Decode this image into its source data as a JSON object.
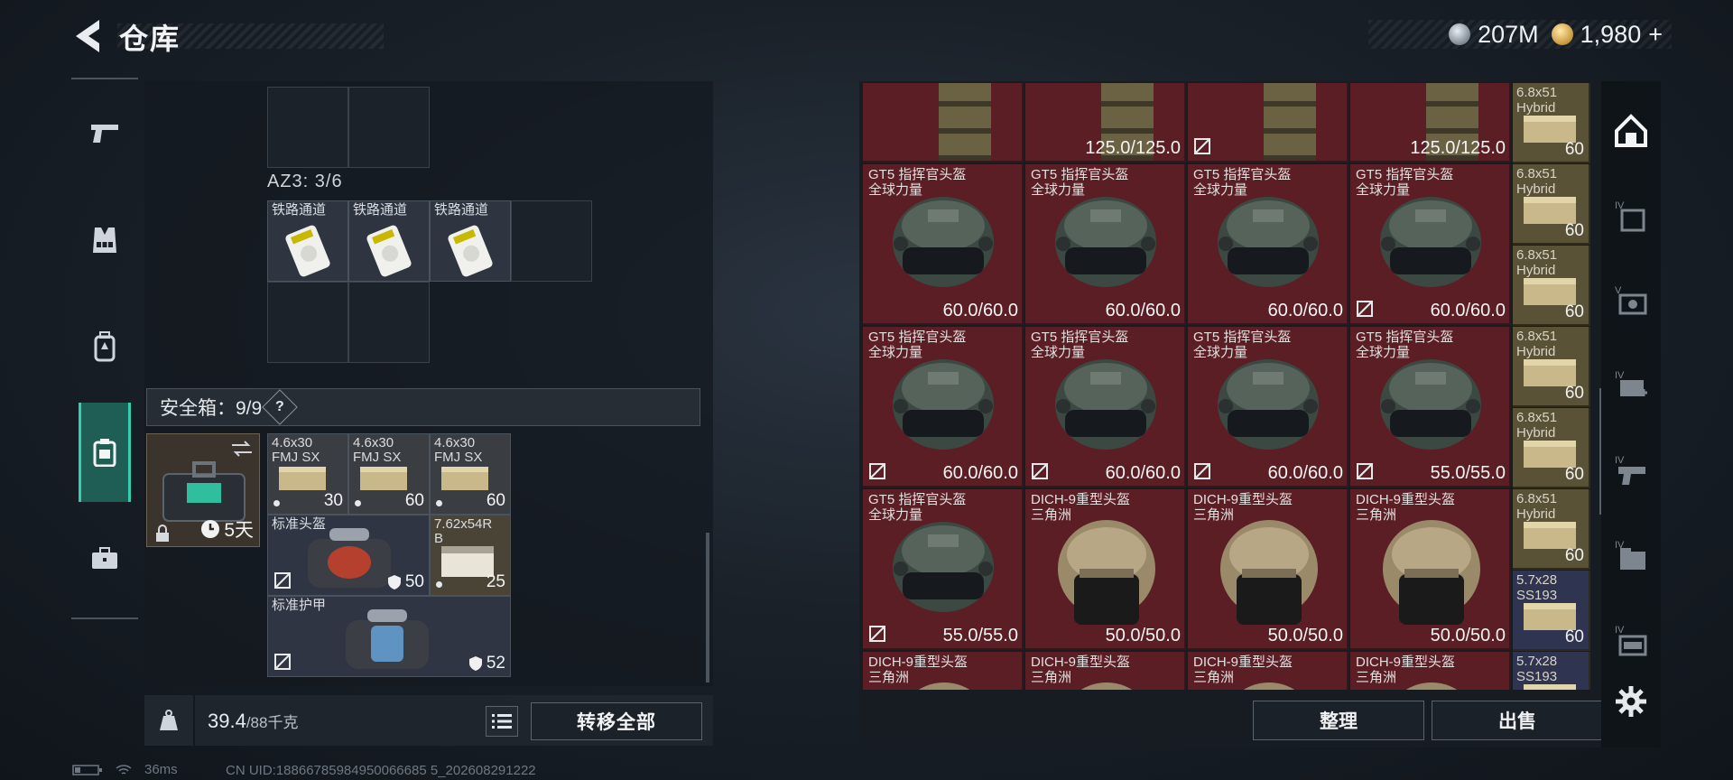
{
  "header": {
    "title": "仓库"
  },
  "currency": {
    "silver": "207M",
    "gold": "1,980",
    "gold_plus": "+"
  },
  "left_nav": {
    "items": [
      "weapon",
      "vest",
      "backpack",
      "safebox",
      "case"
    ],
    "active": "safebox"
  },
  "az3": {
    "label": "AZ3: 3/6",
    "items": [
      {
        "name": "铁路通道"
      },
      {
        "name": "铁路通道"
      },
      {
        "name": "铁路通道"
      }
    ]
  },
  "safebox": {
    "label": "安全箱：9/9",
    "help": "?",
    "days": "5天",
    "items": [
      {
        "name": "4.6x30\nFMJ SX",
        "count": "30"
      },
      {
        "name": "4.6x30\nFMJ SX",
        "count": "60"
      },
      {
        "name": "4.6x30\nFMJ SX",
        "count": "60"
      },
      {
        "name": "标准头盔",
        "count": "50"
      },
      {
        "name": "7.62x54R\nB",
        "count": "25"
      },
      {
        "name": "标准护甲",
        "count": "52"
      }
    ]
  },
  "weight": {
    "current": "39.4",
    "max": "/88千克"
  },
  "buttons": {
    "transfer": "转移全部",
    "sort": "整理",
    "sell": "出售"
  },
  "stash": {
    "row0": [
      {
        "name": "",
        "dur": ""
      },
      {
        "name": "",
        "dur": "125.0/125.0"
      },
      {
        "name": "",
        "dur": ""
      },
      {
        "name": "",
        "dur": "125.0/125.0"
      }
    ],
    "helmets": [
      {
        "name": "GT5 指挥官头盔\n全球力量",
        "dur": "60.0/60.0",
        "nocross": false
      },
      {
        "name": "GT5 指挥官头盔\n全球力量",
        "dur": "60.0/60.0",
        "nocross": false
      },
      {
        "name": "GT5 指挥官头盔\n全球力量",
        "dur": "60.0/60.0",
        "nocross": false
      },
      {
        "name": "GT5 指挥官头盔\n全球力量",
        "dur": "60.0/60.0",
        "nocross": true
      },
      {
        "name": "GT5 指挥官头盔\n全球力量",
        "dur": "60.0/60.0",
        "nocross": true
      },
      {
        "name": "GT5 指挥官头盔\n全球力量",
        "dur": "60.0/60.0",
        "nocross": true
      },
      {
        "name": "GT5 指挥官头盔\n全球力量",
        "dur": "60.0/60.0",
        "nocross": true
      },
      {
        "name": "GT5 指挥官头盔\n全球力量",
        "dur": "55.0/55.0",
        "nocross": true
      },
      {
        "name": "GT5 指挥官头盔\n全球力量",
        "dur": "55.0/55.0",
        "nocross": true
      },
      {
        "name": "DICH-9重型头盔\n三角洲",
        "dur": "50.0/50.0",
        "nocross": false
      },
      {
        "name": "DICH-9重型头盔\n三角洲",
        "dur": "50.0/50.0",
        "nocross": false
      },
      {
        "name": "DICH-9重型头盔\n三角洲",
        "dur": "50.0/50.0",
        "nocross": false
      },
      {
        "name": "DICH-9重型头盔\n三角洲",
        "dur": "",
        "nocross": false
      },
      {
        "name": "DICH-9重型头盔\n三角洲",
        "dur": "",
        "nocross": false
      },
      {
        "name": "DICH-9重型头盔\n三角洲",
        "dur": "",
        "nocross": false
      },
      {
        "name": "DICH-9重型头盔\n三角洲",
        "dur": "",
        "nocross": false
      }
    ],
    "ammo": [
      {
        "name": "6.8x51\nHybrid",
        "count": "60",
        "blue": false
      },
      {
        "name": "6.8x51\nHybrid",
        "count": "60",
        "blue": false
      },
      {
        "name": "6.8x51\nHybrid",
        "count": "60",
        "blue": false
      },
      {
        "name": "6.8x51\nHybrid",
        "count": "60",
        "blue": false
      },
      {
        "name": "6.8x51\nHybrid",
        "count": "60",
        "blue": false
      },
      {
        "name": "6.8x51\nHybrid",
        "count": "60",
        "blue": false
      },
      {
        "name": "5.7x28\nSS193",
        "count": "60",
        "blue": true
      },
      {
        "name": "5.7x28\nSS193",
        "count": "",
        "blue": true
      }
    ]
  },
  "right_nav": [
    "home",
    "tier-iv-a",
    "tier-v",
    "tier-iv-plus",
    "tier-iv-b",
    "tier-iv-c",
    "tier-iv-d"
  ],
  "status": {
    "ping": "36ms",
    "uid": "CN UID:18866785984950066685 5_202608291222"
  }
}
